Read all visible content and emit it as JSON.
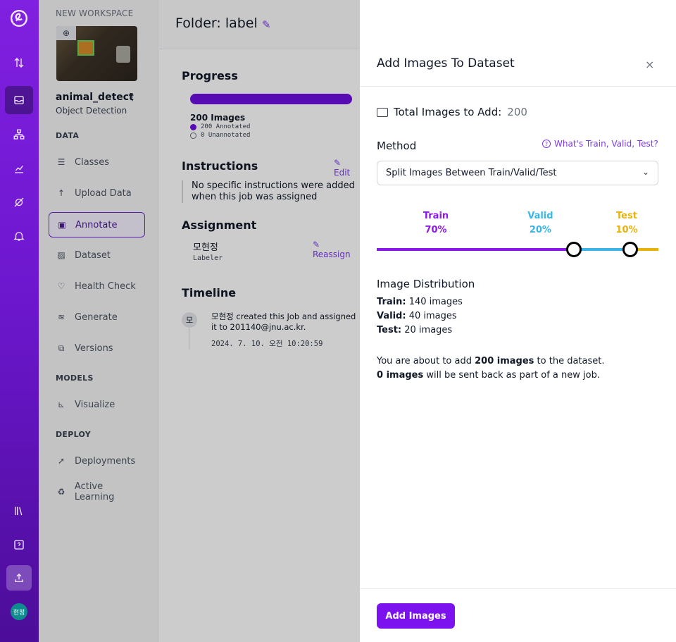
{
  "rail": {
    "items": [
      "logo",
      "upload",
      "projects",
      "workflows",
      "analytics",
      "deploy",
      "notifications",
      "docs",
      "help",
      "upgrade"
    ],
    "avatar_initials": "현정"
  },
  "sidebar": {
    "workspace_label": "NEW WORKSPACE",
    "project_name": "animal_detect",
    "project_menu": "⋮",
    "project_type": "Object Detection",
    "sections": {
      "data": "DATA",
      "models": "MODELS",
      "deploy": "DEPLOY"
    },
    "items": [
      {
        "label": "Classes",
        "icon": "list-icon"
      },
      {
        "label": "Upload Data",
        "icon": "upload-icon"
      },
      {
        "label": "Annotate",
        "icon": "annotate-icon",
        "active": true
      },
      {
        "label": "Dataset",
        "icon": "image-icon"
      },
      {
        "label": "Health Check",
        "icon": "heart-icon"
      },
      {
        "label": "Generate",
        "icon": "layers-icon"
      },
      {
        "label": "Versions",
        "icon": "versions-icon"
      },
      {
        "label": "Visualize",
        "icon": "chart-icon"
      },
      {
        "label": "Deployments",
        "icon": "rocket-icon"
      },
      {
        "label": "Active Learning",
        "icon": "recycle-icon"
      }
    ]
  },
  "main": {
    "folder_title": "Folder: label",
    "progress": {
      "heading": "Progress",
      "annotated_fraction": 1.0,
      "images": "200 Images",
      "annotated": "200 Annotated",
      "unannotated": "0 Unannotated"
    },
    "instructions": {
      "heading": "Instructions",
      "edit": "Edit",
      "text": "No specific instructions were added when this job was assigned"
    },
    "assignment": {
      "heading": "Assignment",
      "reassign": "Reassign",
      "assignee": "모현정",
      "role": "Labeler"
    },
    "timeline": {
      "heading": "Timeline",
      "avatar": "모",
      "event": "모현정 created this Job and assigned it to 201140@jnu.ac.kr.",
      "time": "2024. 7. 10. 오전 10:20:59"
    }
  },
  "panel": {
    "title": "Add Images To Dataset",
    "close": "×",
    "total_label": "Total Images to Add:",
    "total_value": "200",
    "method_label": "Method",
    "help_link": "What's Train, Valid, Test?",
    "method_value": "Split Images Between Train/Valid/Test",
    "split": {
      "train": {
        "label": "Train",
        "pct": "70%",
        "value": 70,
        "color": "#8b18e8"
      },
      "valid": {
        "label": "Valid",
        "pct": "20%",
        "value": 20,
        "color": "#38b6e8"
      },
      "test": {
        "label": "Test",
        "pct": "10%",
        "value": 10,
        "color": "#e8b20c"
      }
    },
    "distribution": {
      "title": "Image Distribution",
      "train_label": "Train:",
      "train_value": "140 images",
      "valid_label": "Valid:",
      "valid_value": "40 images",
      "test_label": "Test:",
      "test_value": "20 images"
    },
    "note": {
      "line1_pre": "You are about to add ",
      "line1_bold": "200 images",
      "line1_post": " to the dataset.",
      "line2_bold": "0 images",
      "line2_post": " will be sent back as part of a new job."
    },
    "add_button": "Add Images"
  }
}
